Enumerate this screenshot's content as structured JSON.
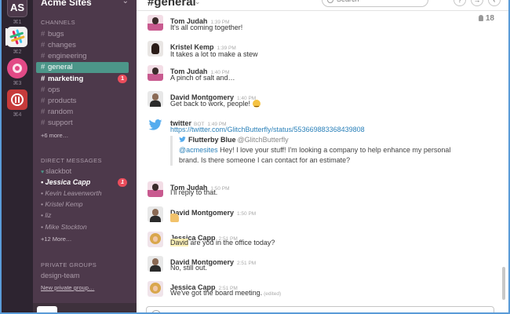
{
  "teams": [
    {
      "label": "AS",
      "num": "⌘1"
    },
    {
      "label": "",
      "num": "⌘2"
    },
    {
      "label": "",
      "num": "⌘3"
    },
    {
      "label": "",
      "num": "⌘4"
    }
  ],
  "sidebar": {
    "team_name": "Acme Sites",
    "channels_header": "CHANNELS",
    "channels": [
      {
        "name": "bugs"
      },
      {
        "name": "changes"
      },
      {
        "name": "engineering"
      },
      {
        "name": "general"
      },
      {
        "name": "marketing",
        "badge": "1"
      },
      {
        "name": "ops"
      },
      {
        "name": "products"
      },
      {
        "name": "random"
      },
      {
        "name": "support"
      }
    ],
    "channels_more": "+6 more…",
    "dm_header": "DIRECT MESSAGES",
    "dms": [
      {
        "name": "slackbot"
      },
      {
        "name": "Jessica Capp",
        "badge": "1"
      },
      {
        "name": "Kevin Leavenworth"
      },
      {
        "name": "Kristel Kemp"
      },
      {
        "name": "liz"
      },
      {
        "name": "Mike Stockton"
      }
    ],
    "dm_more": "+12 More…",
    "pg_header": "PRIVATE GROUPS",
    "private_groups": [
      {
        "name": "design-team"
      }
    ],
    "new_pg": "New private group…"
  },
  "header": {
    "channel": "#general",
    "search_placeholder": "Search",
    "help_label": "?",
    "member_count": "18"
  },
  "messages": [
    {
      "author": "Tom Judah",
      "time": "1:39 PM",
      "text": "It's all coming together!"
    },
    {
      "author": "Kristel Kemp",
      "time": "1:39 PM",
      "text": "It takes a lot to make a stew"
    },
    {
      "author": "Tom Judah",
      "time": "1:40 PM",
      "text": "A pinch of salt and…"
    },
    {
      "author": "David Montgomery",
      "time": "1:40 PM",
      "text": "Get back to work, people!"
    },
    {
      "author": "twitter",
      "bot": "BOT",
      "time": "1:49 PM",
      "text": "https://twitter.com/GlitchButterfly/status/553669883368439808",
      "attachment": {
        "author": "Flutterby Blue",
        "handle": "@GlitchButterfly",
        "mention": "@acmesites",
        "text": " Hey! I love your stuff! I'm looking a company to help enhance my personal brand. Is there someone I can contact for an estimate?"
      }
    },
    {
      "author": "Tom Judah",
      "time": "1:50 PM",
      "text": "I'll reply to that."
    },
    {
      "author": "David Montgomery",
      "time": "1:50 PM",
      "text": ""
    },
    {
      "author": "Jessica Capp",
      "time": "2:51 PM",
      "highlight": "David",
      "text": " are you in the office today?"
    },
    {
      "author": "David Montgomery",
      "time": "2:51 PM",
      "text": "No, still out."
    },
    {
      "author": "Jessica Capp",
      "time": "2:51 PM",
      "text": "We've got the board meeting.",
      "edited": "(edited)"
    }
  ],
  "composer": {
    "value": ""
  }
}
